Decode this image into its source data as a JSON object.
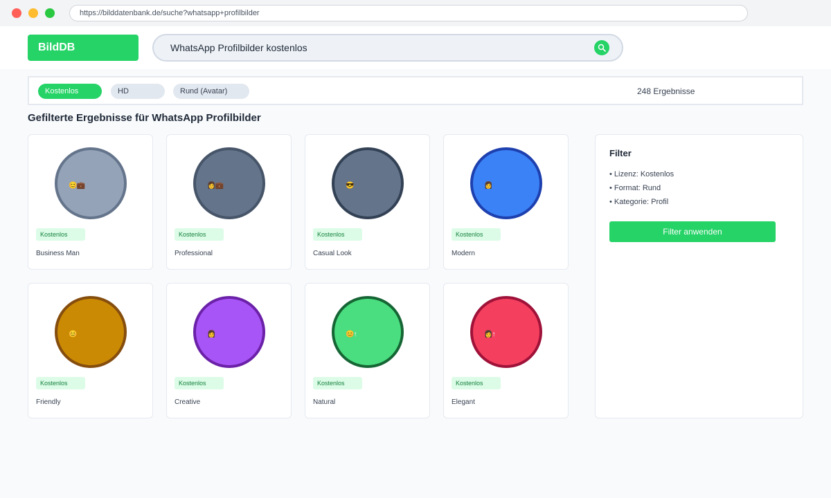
{
  "browser": {
    "url": "https://bilddatenbank.de/suche?whatsapp+profilbilder"
  },
  "header": {
    "logo": "BildDB",
    "search_value": "WhatsApp Profilbilder kostenlos"
  },
  "filters": {
    "chips": [
      "Kostenlos",
      "HD",
      "Rund (Avatar)"
    ],
    "active_chip": "Kostenlos",
    "result_count": "248 Ergebnisse"
  },
  "section_title": "Gefilterte Ergebnisse für WhatsApp Profilbilder",
  "cards": [
    {
      "label": "Business Man",
      "badge": "Kostenlos",
      "fill": "#94a3b8",
      "border": "#64748b",
      "glyph": "😊💼"
    },
    {
      "label": "Professional",
      "badge": "Kostenlos",
      "fill": "#64748b",
      "border": "#475569",
      "glyph": "👩💼"
    },
    {
      "label": "Casual Look",
      "badge": "Kostenlos",
      "fill": "#64748b",
      "border": "#334155",
      "glyph": "😎"
    },
    {
      "label": "Modern",
      "badge": "Kostenlos",
      "fill": "#3b82f6",
      "border": "#1e40af",
      "glyph": "👩"
    },
    {
      "label": "Friendly",
      "badge": "Kostenlos",
      "fill": "#ca8a04",
      "border": "#854d0e",
      "glyph": "😊"
    },
    {
      "label": "Creative",
      "badge": "Kostenlos",
      "fill": "#a855f7",
      "border": "#6b21a8",
      "glyph": "👩"
    },
    {
      "label": "Natural",
      "badge": "Kostenlos",
      "fill": "#4ade80",
      "border": "#166534",
      "glyph": "😊↑"
    },
    {
      "label": "Elegant",
      "badge": "Kostenlos",
      "fill": "#f43f5e",
      "border": "#9f1239",
      "glyph": "👩↑"
    }
  ],
  "sidebar": {
    "title": "Filter",
    "items": [
      "• Lizenz: Kostenlos",
      "• Format: Rund",
      "• Kategorie: Profil"
    ],
    "apply_label": "Filter anwenden"
  },
  "colors": {
    "accent": "#25d366",
    "badge_bg": "#dcfce7",
    "badge_text": "#15803d"
  }
}
